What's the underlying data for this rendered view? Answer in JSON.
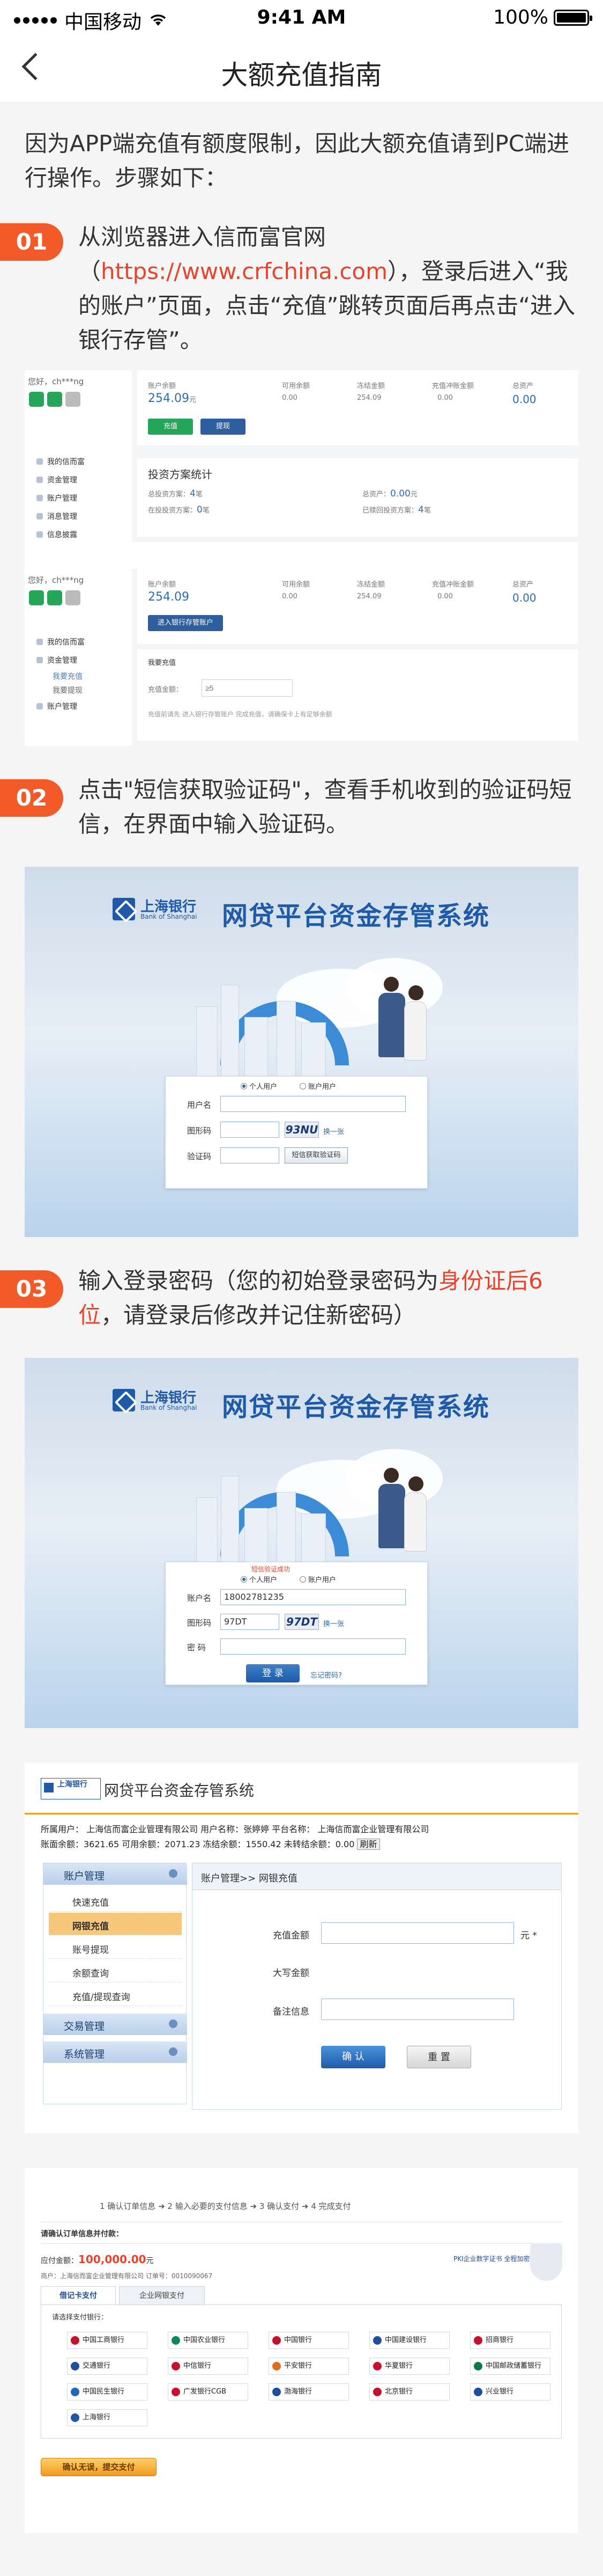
{
  "statusbar": {
    "carrier": "中国移动",
    "time": "9:41 AM",
    "battery": "100%"
  },
  "nav": {
    "title": "大额充值指南"
  },
  "intro": "因为APP端充值有额度限制，因此大额充值请到PC端进行操作。步骤如下：",
  "steps": [
    {
      "num": "01",
      "pre": "从浏览器进入信而富官网（",
      "link": "https://www.crfchina.com",
      "post": "），登录后进入“我的账户”页面，点击“充值”跳转页面后再点击“进入银行存管”。"
    },
    {
      "num": "02",
      "text": "点击\"短信获取验证码\"，查看手机收到的验证码短信，在界面中输入验证码。"
    },
    {
      "num": "03",
      "pre": "输入登录密码（您的初始登录密码为",
      "red": "身份证后6位",
      "post": "，请登录后修改并记住新密码）"
    }
  ],
  "account": {
    "user": "您好，ch***ng",
    "menu1": [
      "我的信而富",
      "资金管理",
      "账户管理",
      "消息管理",
      "信息披露"
    ],
    "menu2": [
      "我的信而富",
      "资金管理",
      "我要充值",
      "我要提现",
      "账户管理"
    ],
    "labels": [
      "账户余额",
      "可用余额",
      "冻结金额",
      "充值冲账金额",
      "总资产"
    ],
    "balance": "254.09",
    "unit": "元",
    "zero": "0.00",
    "recharge_btn": "充值",
    "withdraw_btn": "提现",
    "bank_btn": "进入银行存管账户",
    "stats_title": "投资方案统计",
    "stats": [
      {
        "k": "总投资方案：",
        "v": "4",
        "u": "笔"
      },
      {
        "k": "总资产：",
        "v": "0.00",
        "u": "元"
      },
      {
        "k": "在投投资方案：",
        "v": "0",
        "u": "笔"
      },
      {
        "k": "已赎回投资方案：",
        "v": "4",
        "u": "笔"
      }
    ],
    "recharge_section": "我要充值",
    "recharge_label": "充值金额：",
    "recharge_placeholder": "≥5",
    "recharge_tip": "充值前请先 进入银行存管账户 完成充值，请确保卡上有足够余额"
  },
  "bank": {
    "name_cn": "上海银行",
    "name_en": "Bank of Shanghai",
    "system": "网贷平台资金存管系统",
    "radio_personal": "个人用户",
    "radio_company": "账户用户",
    "user_label": "用户名",
    "captcha_label": "图形码",
    "sms_label": "验证码",
    "captcha1": "93NU",
    "refresh": "换一张",
    "sms_btn": "短信获取验证码",
    "verify_ok": "短信验证成功",
    "account_label": "账户名",
    "account_value": "18002781235",
    "captcha_value": "97DT",
    "captcha2": "97DT",
    "pwd_label": "密 码",
    "login_btn": "登 录",
    "forgot": "忘记密码?"
  },
  "recharge": {
    "logo": "上海银行",
    "title": "网贷平台资金存管系统",
    "info1": "所属用户：  上海信而富企业管理有限公司      用户名称：张婷婷   平台名称：  上海信而富企业管理有限公司",
    "info1_highlight": "张婷婷",
    "info2": "账面余额：3621.65  可用余额：2071.23  冻结余额：1550.42  未转结余额：0.00",
    "refresh": "刷新",
    "groups": [
      "账户管理",
      "交易管理",
      "系统管理"
    ],
    "items": [
      "快速充值",
      "网银充值",
      "账号提现",
      "余额查询",
      "充值/提现查询"
    ],
    "crumb": "账户管理>> 网银充值",
    "amount_label": "充值金额",
    "amount_unit": "元 *",
    "upper_label": "大写金额",
    "note_label": "备注信息",
    "ok_btn": "确 认",
    "reset_btn": "重 置"
  },
  "payment": {
    "steps": "1 确认订单信息  ➜  2 输入必要的支付信息  ➜  3 确认支付  ➜  4 完成支付",
    "order_title": "请确认订单信息并付款：",
    "amount_label": "应付金额：",
    "amount": "100,000.00",
    "amount_unit": "元",
    "merchant": "商户：上海信而富企业管理有限公司    订单号：0010090067",
    "cert": "PKI企业数字证书 全程加密",
    "tab1": "借记卡支付",
    "tab2": "企业网银支付",
    "choose": "请选择支付银行：",
    "banks": [
      "中国工商银行",
      "中国农业银行",
      "中国银行",
      "中国建设银行",
      "招商银行",
      "交通银行",
      "中信银行",
      "平安银行",
      "华夏银行",
      "中国邮政储蓄银行",
      "中国民生银行",
      "广发银行CGB",
      "渤海银行",
      "北京银行",
      "兴业银行",
      "上海银行"
    ],
    "bank_colors": [
      "#c8102e",
      "#0a8a5a",
      "#c8102e",
      "#1d4f9c",
      "#c8102e",
      "#1d4f9c",
      "#c8102e",
      "#e36b1b",
      "#c8102e",
      "#0a7a4a",
      "#1d6bb0",
      "#c8102e",
      "#1d4f9c",
      "#c8102e",
      "#1d4f9c",
      "#1e5aa8"
    ],
    "pay_btn": "确认无误，提交支付"
  }
}
